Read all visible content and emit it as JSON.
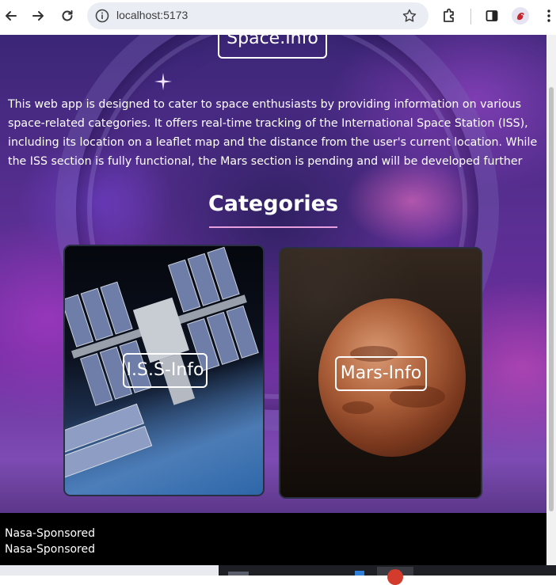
{
  "browser": {
    "url": "localhost:5173",
    "icons": {
      "back": "arrow-left-icon",
      "forward": "arrow-right-icon",
      "reload": "reload-icon",
      "site_info": "site-info-icon",
      "bookmark": "star-icon",
      "extensions": "puzzle-icon",
      "side_panel": "side-panel-icon",
      "profile": "profile-avatar",
      "menu": "kebab-menu-icon"
    }
  },
  "header": {
    "brand": "Space.Info"
  },
  "intro": {
    "text": "This web app is designed to cater to space enthusiasts by providing information on various space-related categories. It offers real-time tracking of the International Space Station (ISS), including its location on a leaflet map and the distance from the user's current location. While the ISS section is fully functional, the Mars section is pending and will be developed further"
  },
  "categories": {
    "title": "Categories",
    "items": [
      {
        "label": "I.S.S-Info"
      },
      {
        "label": "Mars-Info"
      }
    ]
  },
  "footer": {
    "lines": [
      "Nasa-Sponsored",
      "Nasa-Sponsored"
    ]
  },
  "colors": {
    "accent_underline": "#e7a0dd",
    "footer_bg": "#000000",
    "text": "#ffffff"
  }
}
